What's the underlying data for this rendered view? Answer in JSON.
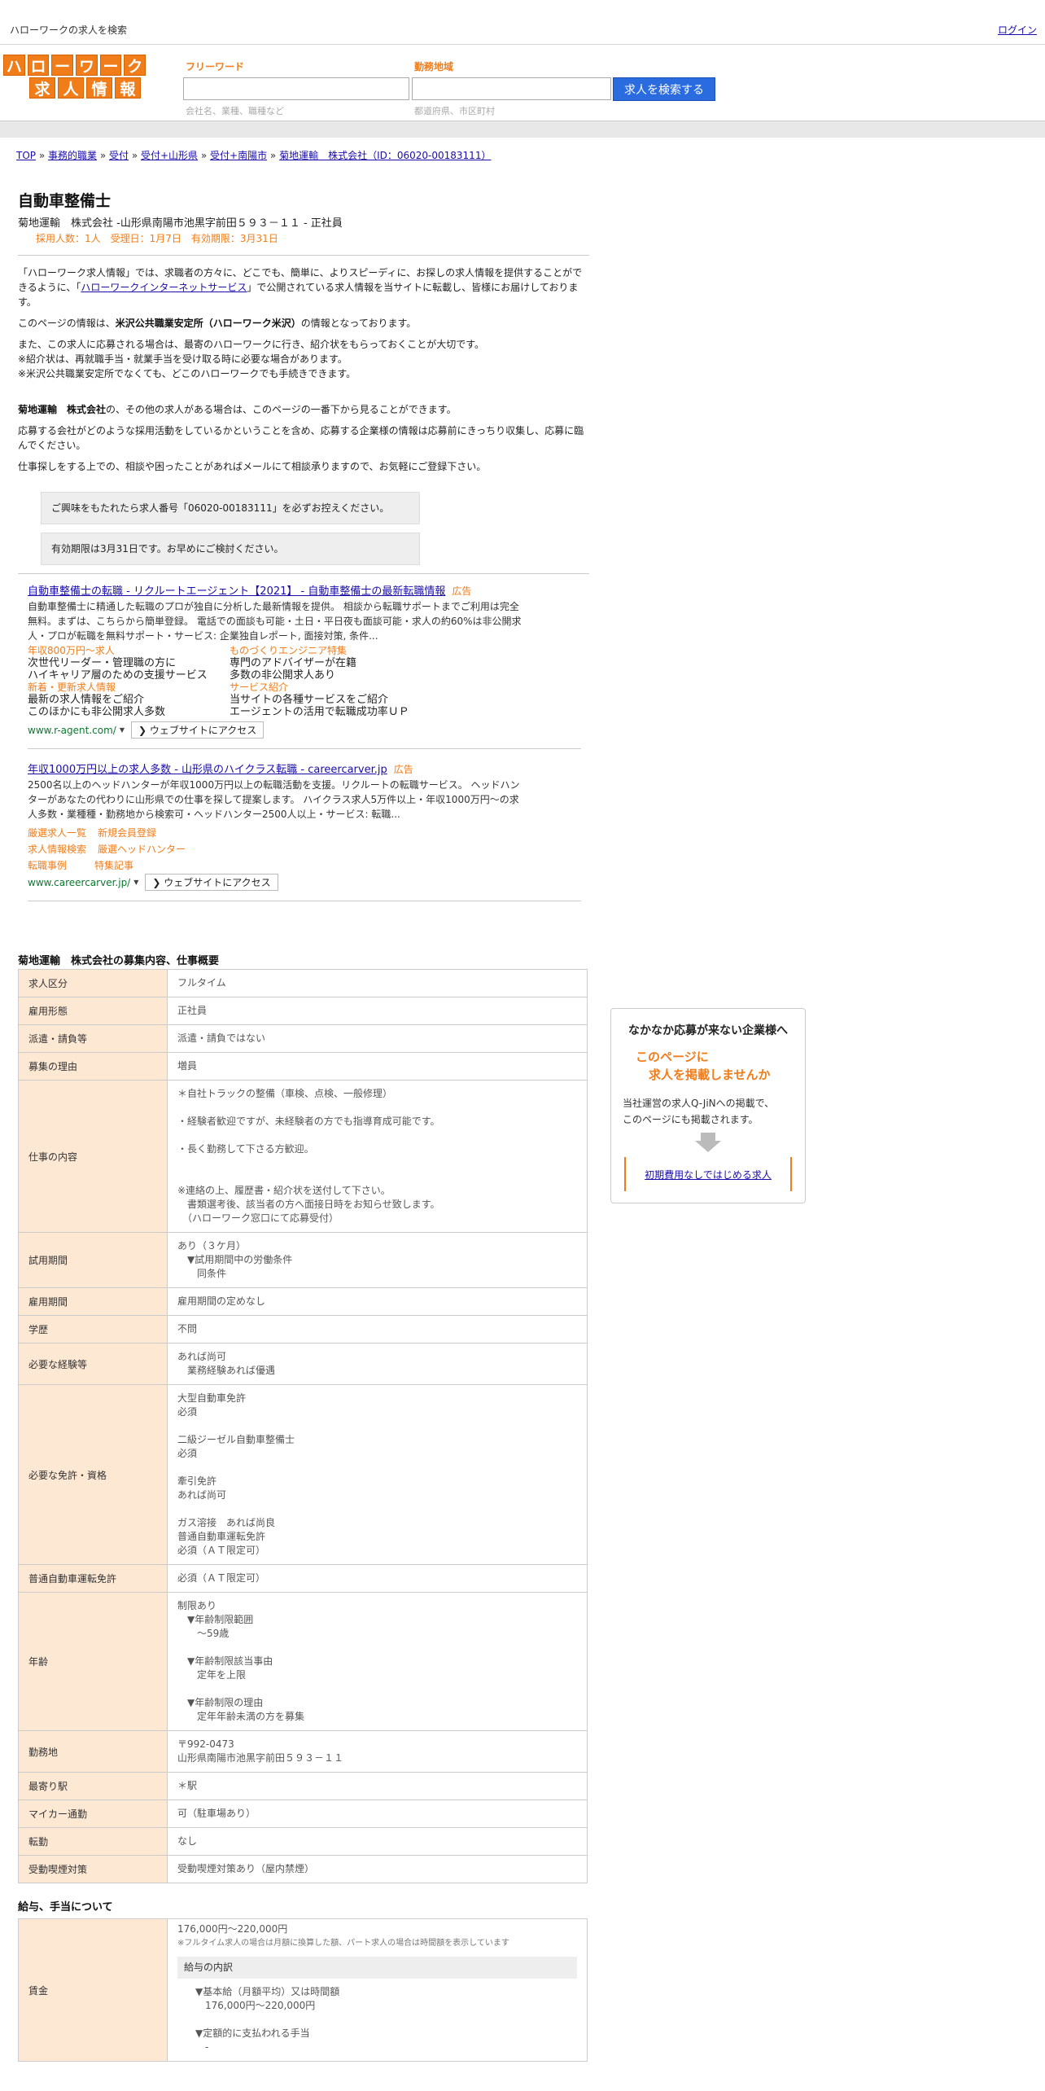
{
  "topbar": {
    "site_title": "ハローワークの求人を検索",
    "login": "ログイン"
  },
  "logo": {
    "row1": [
      "ハ",
      "ロ",
      "ー",
      "ワ",
      "ー",
      "ク"
    ],
    "row2": [
      "求",
      "人",
      "情",
      "報"
    ]
  },
  "search": {
    "freeword_label": "フリーワード",
    "freeword_placeholder": "",
    "freeword_hint": "会社名、業種、職種など",
    "area_label": "勤務地域",
    "area_placeholder": "",
    "area_hint": "都道府県、市区町村",
    "button": "求人を検索する"
  },
  "breadcrumb": [
    "TOP",
    "事務的職業",
    "受付",
    "受付+山形県",
    "受付+南陽市",
    "菊地運輸　株式会社（ID：06020-00183111）"
  ],
  "breadcrumb_sep": " » ",
  "job": {
    "title": "自動車整備士",
    "subtitle": "菊地運輸　株式会社 -山形県南陽市池黒字前田５９３－１１ - 正社員",
    "meta": "採用人数：1人　受理日：1月7日　有効期限：3月31日"
  },
  "intro": {
    "p1_a": "「ハローワーク求人情報」では、求職者の方々に、どこでも、簡単に、よりスピーディに、お探しの求人情報を提供することができるように、「",
    "p1_link": "ハローワークインターネットサービス",
    "p1_b": "」で公開されている求人情報を当サイトに転載し、皆様にお届けしております。",
    "p2_a": "このページの情報は、",
    "p2_b": "米沢公共職業安定所（ハローワーク米沢）",
    "p2_c": "の情報となっております。",
    "p3_1": "また、この求人に応募される場合は、最寄のハローワークに行き、紹介状をもらっておくことが大切です。",
    "p3_2": "※紹介状は、再就職手当・就業手当を受け取る時に必要な場合があります。",
    "p3_3": "※米沢公共職業安定所でなくても、どこのハローワークでも手続きできます。",
    "p4_a": "菊地運輸　株式会社",
    "p4_b": "の、その他の求人がある場合は、このページの一番下から見ることができます。",
    "p5": "応募する会社がどのような採用活動をしているかということを含め、応募する企業様の情報は応募前にきっちり収集し、応募に臨んでください。",
    "p6": "仕事探しをする上での、相談や困ったことがあればメールにて相談承りますので、お気軽にご登録下さい。"
  },
  "notices": [
    "ご興味をもたれたら求人番号「06020-00183111」を必ずお控えください。",
    "有効期限は3月31日です。お早めにご検討ください。"
  ],
  "ads": [
    {
      "title": "自動車整備士の転職 - リクルートエージェント【2021】 - 自動車整備士の最新転職情報",
      "badge": "広告",
      "desc": "自動車整備士に精通した転職のプロが独自に分析した最新情報を提供。 相談から転職サポートまでご利用は完全無料。まずは、こちらから簡単登録。 電話での面談も可能・土日・平日夜も面談可能・求人の約60%は非公開求人・プロが転職を無料サポート・サービス: 企業独自レポート, 面接対策, 条件...",
      "sitelinks": [
        {
          "head": "年収800万円～求人",
          "l1": "次世代リーダー・管理職の方に",
          "l2": "ハイキャリア層のための支援サービス"
        },
        {
          "head": "ものづくりエンジニア特集",
          "l1": "専門のアドバイザーが在籍",
          "l2": "多数の非公開求人あり"
        },
        {
          "head": "新着・更新求人情報",
          "l1": "最新の求人情報をご紹介",
          "l2": "このほかにも非公開求人多数"
        },
        {
          "head": "サービス紹介",
          "l1": "当サイトの各種サービスをご紹介",
          "l2": "エージェントの活用で転職成功率ＵＰ"
        }
      ],
      "url": "www.r-agent.com/",
      "visit": "❯ ウェブサイトにアクセス"
    },
    {
      "title": "年収1000万円以上の求人多数 - 山形県のハイクラス転職 - careercarver.jp",
      "badge": "広告",
      "desc": "2500名以上のヘッドハンターが年収1000万円以上の転職活動を支援。リクルートの転職サービス。 ヘッドハンターがあなたの代わりに山形県での仕事を探して提案します。 ハイクラス求人5万件以上・年収1000万円～の求人多数・業種種・勤務地から検索可・ヘッドハンター2500人以上・サービス: 転職...",
      "links": [
        [
          "厳選求人一覧",
          "新規会員登録"
        ],
        [
          "求人情報検索",
          "厳選ヘッドハンター"
        ],
        [
          "転職事例",
          "特集記事"
        ]
      ],
      "url": "www.careercarver.jp/",
      "visit": "❯ ウェブサイトにアクセス"
    }
  ],
  "details_title": "菊地運輸　株式会社の募集内容、仕事概要",
  "details": [
    {
      "k": "求人区分",
      "v": [
        "フルタイム"
      ]
    },
    {
      "k": "雇用形態",
      "v": [
        "正社員"
      ]
    },
    {
      "k": "派遣・請負等",
      "v": [
        "派遣・請負ではない"
      ]
    },
    {
      "k": "募集の理由",
      "v": [
        "増員"
      ]
    },
    {
      "k": "仕事の内容",
      "v": [
        "＊自社トラックの整備（車検、点検、一般修理）",
        "",
        "・経験者歓迎ですが、未経験者の方でも指導育成可能です。",
        "",
        "・長く勤務して下さる方歓迎。",
        "",
        "",
        "※連絡の上、履歴書・紹介状を送付して下さい。",
        "　書類選考後、該当者の方へ面接日時をお知らせ致します。",
        "　（ハローワーク窓口にて応募受付）"
      ]
    },
    {
      "k": "試用期間",
      "v": [
        "あり（３ケ月）",
        "　▼試用期間中の労働条件",
        "　　同条件"
      ]
    },
    {
      "k": "雇用期間",
      "v": [
        "雇用期間の定めなし"
      ]
    },
    {
      "k": "学歴",
      "v": [
        "不問"
      ]
    },
    {
      "k": "必要な経験等",
      "v": [
        "あれば尚可",
        "　業務経験あれば優遇"
      ]
    },
    {
      "k": "必要な免許・資格",
      "v": [
        "大型自動車免許",
        "必須",
        "",
        "二級ジーゼル自動車整備士",
        "必須",
        "",
        "牽引免許",
        "あれば尚可",
        "",
        "ガス溶接　あれば尚良",
        "普通自動車運転免許",
        "必須（ＡＴ限定可）"
      ]
    },
    {
      "k": "普通自動車運転免許",
      "v": [
        "必須（ＡＴ限定可）"
      ]
    },
    {
      "k": "年齢",
      "v": [
        "制限あり",
        "　▼年齢制限範囲",
        "　　～59歳",
        "",
        "　▼年齢制限該当事由",
        "　　定年を上限",
        "",
        "　▼年齢制限の理由",
        "　　定年年齢未満の方を募集"
      ]
    },
    {
      "k": "勤務地",
      "v": [
        "〒992-0473",
        "山形県南陽市池黒字前田５９３－１１"
      ]
    },
    {
      "k": "最寄り駅",
      "v": [
        "＊駅"
      ]
    },
    {
      "k": "マイカー通勤",
      "v": [
        "可（駐車場あり）"
      ]
    },
    {
      "k": "転勤",
      "v": [
        "なし"
      ]
    },
    {
      "k": "受動喫煙対策",
      "v": [
        "受動喫煙対策あり（屋内禁煙）"
      ]
    }
  ],
  "salary_title": "給与、手当について",
  "salary": {
    "k": "賃金",
    "range": "176,000円〜220,000円",
    "note": "※フルタイム求人の場合は月額に換算した額、パート求人の場合は時間額を表示しています",
    "breakdown_title": "給与の内訳",
    "items": [
      "▼基本給（月額平均）又は時間額",
      "　176,000円〜220,000円",
      "",
      "▼定額的に支払われる手当",
      "　-"
    ]
  },
  "sidebox": {
    "title": "なかなか応募が来ない企業様へ",
    "hl1": "このページに",
    "hl2": "求人を掲載しませんか",
    "body1": "当社運営の求人Q-JiNへの掲載で、",
    "body2": "このページにも掲載されます。",
    "link": "初期費用なしではじめる求人"
  },
  "colors": {
    "accent": "#f07d1a",
    "link": "#1a0dab",
    "button": "#2a6be0",
    "label_bg": "#fde8d4"
  }
}
